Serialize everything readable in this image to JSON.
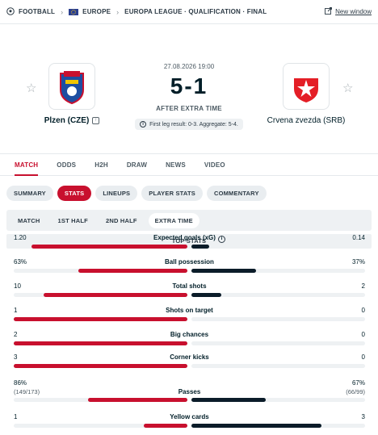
{
  "breadcrumb": {
    "sport": "FOOTBALL",
    "region": "EUROPE",
    "competition": "EUROPA LEAGUE · QUALIFICATION · FINAL",
    "new_window": "New window"
  },
  "match": {
    "datetime": "27.08.2026 19:00",
    "score": "5-1",
    "status": "AFTER EXTRA TIME",
    "aggregate_note": "First leg result: 0-3. Aggregate: 5-4.",
    "home": {
      "name": "Plzen (CZE)",
      "color": "#c8102e"
    },
    "away": {
      "name": "Crvena zvezda (SRB)",
      "color": "#0b1c29"
    }
  },
  "tabs": [
    "MATCH",
    "ODDS",
    "H2H",
    "DRAW",
    "NEWS",
    "VIDEO"
  ],
  "active_tab": "MATCH",
  "subtabs": [
    "SUMMARY",
    "STATS",
    "LINEUPS",
    "PLAYER STATS",
    "COMMENTARY"
  ],
  "active_subtab": "STATS",
  "periods": [
    "MATCH",
    "1ST HALF",
    "2ND HALF",
    "EXTRA TIME"
  ],
  "active_period": "EXTRA TIME",
  "section_title": "TOP STATS",
  "stats": [
    {
      "label": "Expected goals (xG)",
      "home": "1.20",
      "away": "0.14",
      "home_share": 0.9,
      "away_share": 0.1,
      "info": true
    },
    {
      "label": "Ball possession",
      "home": "63%",
      "away": "37%",
      "home_share": 0.63,
      "away_share": 0.37
    },
    {
      "label": "Total shots",
      "home": "10",
      "away": "2",
      "home_share": 0.83,
      "away_share": 0.17
    },
    {
      "label": "Shots on target",
      "home": "1",
      "away": "0",
      "home_share": 1.0,
      "away_share": 0.0
    },
    {
      "label": "Big chances",
      "home": "2",
      "away": "0",
      "home_share": 1.0,
      "away_share": 0.0
    },
    {
      "label": "Corner kicks",
      "home": "3",
      "away": "0",
      "home_share": 1.0,
      "away_share": 0.0
    },
    {
      "label": "Passes",
      "home": "86%",
      "away": "67%",
      "home_sub": "(149/173)",
      "away_sub": "(66/99)",
      "home_share": 0.57,
      "away_share": 0.43
    },
    {
      "label": "Yellow cards",
      "home": "1",
      "away": "3",
      "home_share": 0.25,
      "away_share": 0.75
    }
  ]
}
